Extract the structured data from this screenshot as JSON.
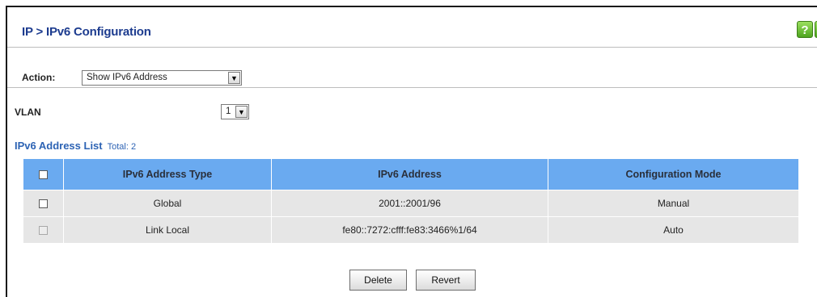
{
  "header": {
    "title": "IP > IPv6 Configuration",
    "help_icon_glyph": "?",
    "refresh_icon_glyph": "C"
  },
  "action": {
    "label": "Action:",
    "selected": "Show IPv6 Address",
    "arrow": "▼"
  },
  "vlan": {
    "label": "VLAN",
    "selected": "1",
    "arrow": "▼"
  },
  "list": {
    "title": "IPv6 Address List",
    "total": "Total: 2"
  },
  "table": {
    "columns": [
      "",
      "IPv6 Address Type",
      "IPv6 Address",
      "Configuration Mode"
    ],
    "rows": [
      {
        "type": "Global",
        "address": "2001::2001/96",
        "mode": "Manual",
        "checkbox_disabled": false
      },
      {
        "type": "Link Local",
        "address": "fe80::7272:cfff:fe83:3466%1/64",
        "mode": "Auto",
        "checkbox_disabled": true
      }
    ]
  },
  "buttons": {
    "delete": "Delete",
    "revert": "Revert"
  },
  "colors": {
    "title": "#1d3c8f",
    "table_header": "#6aaaf0",
    "row_bg": "#e6e6e6",
    "list_title": "#2d63b4"
  }
}
